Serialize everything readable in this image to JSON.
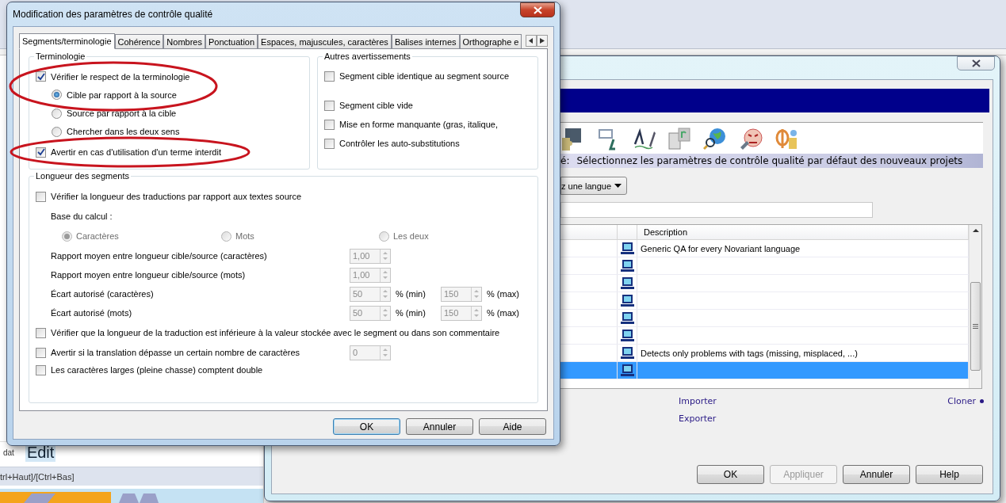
{
  "background_app": {
    "row_label": "dat",
    "edit_label": "Edit",
    "status_hint": "trl+Haut]/[Ctrl+Bas]"
  },
  "back_dialog": {
    "info_label": "é:",
    "info_text": "Sélectionnez les paramètres de contrôle qualité par défaut des nouveaux projets",
    "language_dropdown": "z une langue",
    "table": {
      "columns": [
        "Description"
      ],
      "rows": [
        {
          "description": "Generic QA for every Novariant language",
          "selected": false
        },
        {
          "description": "",
          "selected": false
        },
        {
          "description": "",
          "selected": false
        },
        {
          "description": "",
          "selected": false
        },
        {
          "description": "",
          "selected": false
        },
        {
          "description": "",
          "selected": false
        },
        {
          "description": "Detects only problems with tags (missing, misplaced, ...)",
          "selected": false
        },
        {
          "description": "",
          "selected": true
        }
      ]
    },
    "links": [
      "Importer",
      "Exporter"
    ],
    "clone_link": "Cloner",
    "buttons": [
      {
        "label": "OK",
        "disabled": false
      },
      {
        "label": "Appliquer",
        "disabled": true
      },
      {
        "label": "Annuler",
        "disabled": false
      },
      {
        "label": "Help",
        "disabled": false
      }
    ]
  },
  "front_dialog": {
    "title": "Modification des paramètres de contrôle qualité",
    "tabs": [
      {
        "label": "Segments/terminologie",
        "selected": true
      },
      {
        "label": "Cohérence",
        "selected": false
      },
      {
        "label": "Nombres",
        "selected": false
      },
      {
        "label": "Ponctuation",
        "selected": false
      },
      {
        "label": "Espaces, majuscules, caractères",
        "selected": false
      },
      {
        "label": "Balises internes",
        "selected": false
      },
      {
        "label": "Orthographe e",
        "selected": false
      }
    ],
    "terminology": {
      "title": "Terminologie",
      "items": [
        {
          "kind": "checkbox",
          "label": "Vérifier le respect de la terminologie",
          "checked": true
        },
        {
          "kind": "radio",
          "label": "Cible par rapport à la source",
          "selected": true
        },
        {
          "kind": "radio",
          "label": "Source par rapport à la cible",
          "selected": false
        },
        {
          "kind": "radio",
          "label": "Chercher dans les deux sens",
          "selected": false
        },
        {
          "kind": "checkbox",
          "label": "Avertir en cas d'utilisation d'un terme interdit",
          "checked": true
        }
      ]
    },
    "other_warnings": {
      "title": "Autres avertissements",
      "items": [
        {
          "label": "Segment cible identique au segment source",
          "checked": false
        },
        {
          "label": "Segment cible vide",
          "checked": false
        },
        {
          "label": "Mise en forme manquante (gras, italique,",
          "checked": false
        },
        {
          "label": "Contrôler les auto-substitutions",
          "checked": false
        }
      ]
    },
    "segment_length": {
      "title": "Longueur des segments",
      "items": [
        {
          "kind": "checkbox",
          "label": "Vérifier la longueur des traductions par rapport aux textes source",
          "checked": false
        },
        {
          "kind": "label",
          "label": "Base du calcul :"
        },
        {
          "kind": "radios",
          "options": [
            {
              "label": "Caractères",
              "selected": true
            },
            {
              "label": "Mots",
              "selected": false
            },
            {
              "label": "Les deux",
              "selected": false
            }
          ],
          "disabled": true
        },
        {
          "kind": "spin",
          "label": "Rapport moyen entre longueur cible/source (caractères)",
          "fields": [
            {
              "value": "1,00"
            }
          ]
        },
        {
          "kind": "spin",
          "label": "Rapport moyen entre longueur cible/source (mots)",
          "fields": [
            {
              "value": "1,00"
            }
          ]
        },
        {
          "kind": "spin",
          "label": "Écart autorisé (caractères)",
          "fields": [
            {
              "value": "50",
              "unit": "% (min)"
            },
            {
              "value": "150",
              "unit": "% (max)"
            }
          ]
        },
        {
          "kind": "spin",
          "label": "Écart autorisé (mots)",
          "fields": [
            {
              "value": "50",
              "unit": "% (min)"
            },
            {
              "value": "150",
              "unit": "% (max)"
            }
          ]
        },
        {
          "kind": "checkbox",
          "label": "Vérifier que la longueur de la traduction est inférieure à la valeur stockée avec le segment ou dans son commentaire",
          "checked": false
        },
        {
          "kind": "checkbox",
          "label": "Avertir si la translation dépasse un certain nombre de caractères",
          "checked": false,
          "fields": [
            {
              "value": "0"
            }
          ]
        },
        {
          "kind": "checkbox",
          "label": "Les caractères larges (pleine chasse) comptent double",
          "checked": false
        }
      ]
    },
    "buttons": [
      {
        "label": "OK",
        "default": true
      },
      {
        "label": "Annuler",
        "default": false
      },
      {
        "label": "Aide",
        "default": false
      }
    ]
  }
}
